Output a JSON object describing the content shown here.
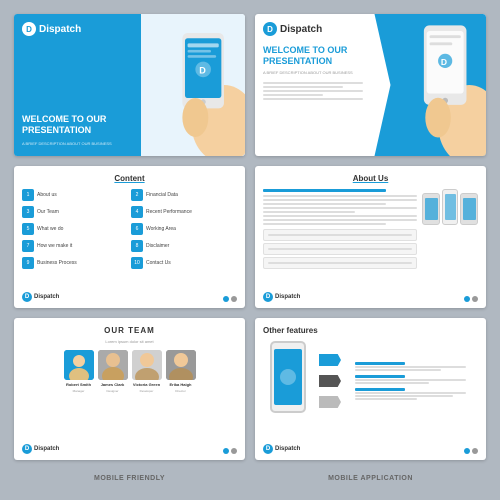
{
  "slides": [
    {
      "id": "slide-1",
      "logo": "D",
      "brand": "Dispatch",
      "heading": "WELCOME TO OUR PRESENTATION",
      "subheading": "A BRIEF DESCRIPTION ABOUT OUR BUSINESS"
    },
    {
      "id": "slide-2",
      "logo": "D",
      "brand": "Dispatch",
      "heading": "WELCOME TO OUR PRESENTATION",
      "subheading": "A BRIEF DESCRIPTION ABOUT OUR BUSINESS"
    },
    {
      "id": "slide-3",
      "title": "Content",
      "items": [
        {
          "num": "1",
          "label": "About us"
        },
        {
          "num": "2",
          "label": "Financial Data"
        },
        {
          "num": "3",
          "label": "Our Team"
        },
        {
          "num": "4",
          "label": "Recent Performance"
        },
        {
          "num": "5",
          "label": "What we do"
        },
        {
          "num": "6",
          "label": "Working Area"
        },
        {
          "num": "7",
          "label": "How we make it"
        },
        {
          "num": "8",
          "label": "Disclaimer"
        },
        {
          "num": "9",
          "label": "Business Process"
        },
        {
          "num": "10",
          "label": "Contact Us"
        }
      ]
    },
    {
      "id": "slide-4",
      "title": "About Us"
    },
    {
      "id": "slide-5",
      "title": "OUR TEAM",
      "subtitle": "Lorem ipsum dolor sit amet",
      "members": [
        {
          "name": "Robert Smith",
          "role": "Manager"
        },
        {
          "name": "James Clark",
          "role": "Designer"
        },
        {
          "name": "Victoria Green",
          "role": "Developer"
        },
        {
          "name": "Erika Haigh",
          "role": "Director"
        }
      ]
    },
    {
      "id": "slide-6",
      "title": "Other features",
      "features": [
        {
          "title": "Lorem ipsum",
          "desc": "available, but the majority"
        },
        {
          "title": "variations of passages",
          "desc": "of Lorem ipsum, but a"
        },
        {
          "title": "Lorem ipsum",
          "desc": "available, but the majority quite forms to"
        }
      ]
    }
  ],
  "bottom_labels": [
    {
      "text": "Mobile Friendly"
    },
    {
      "text": "Mobile Application"
    }
  ],
  "colors": {
    "primary": "#1a9cd8",
    "dark": "#333",
    "gray": "#999",
    "light": "#f5f5f5"
  }
}
